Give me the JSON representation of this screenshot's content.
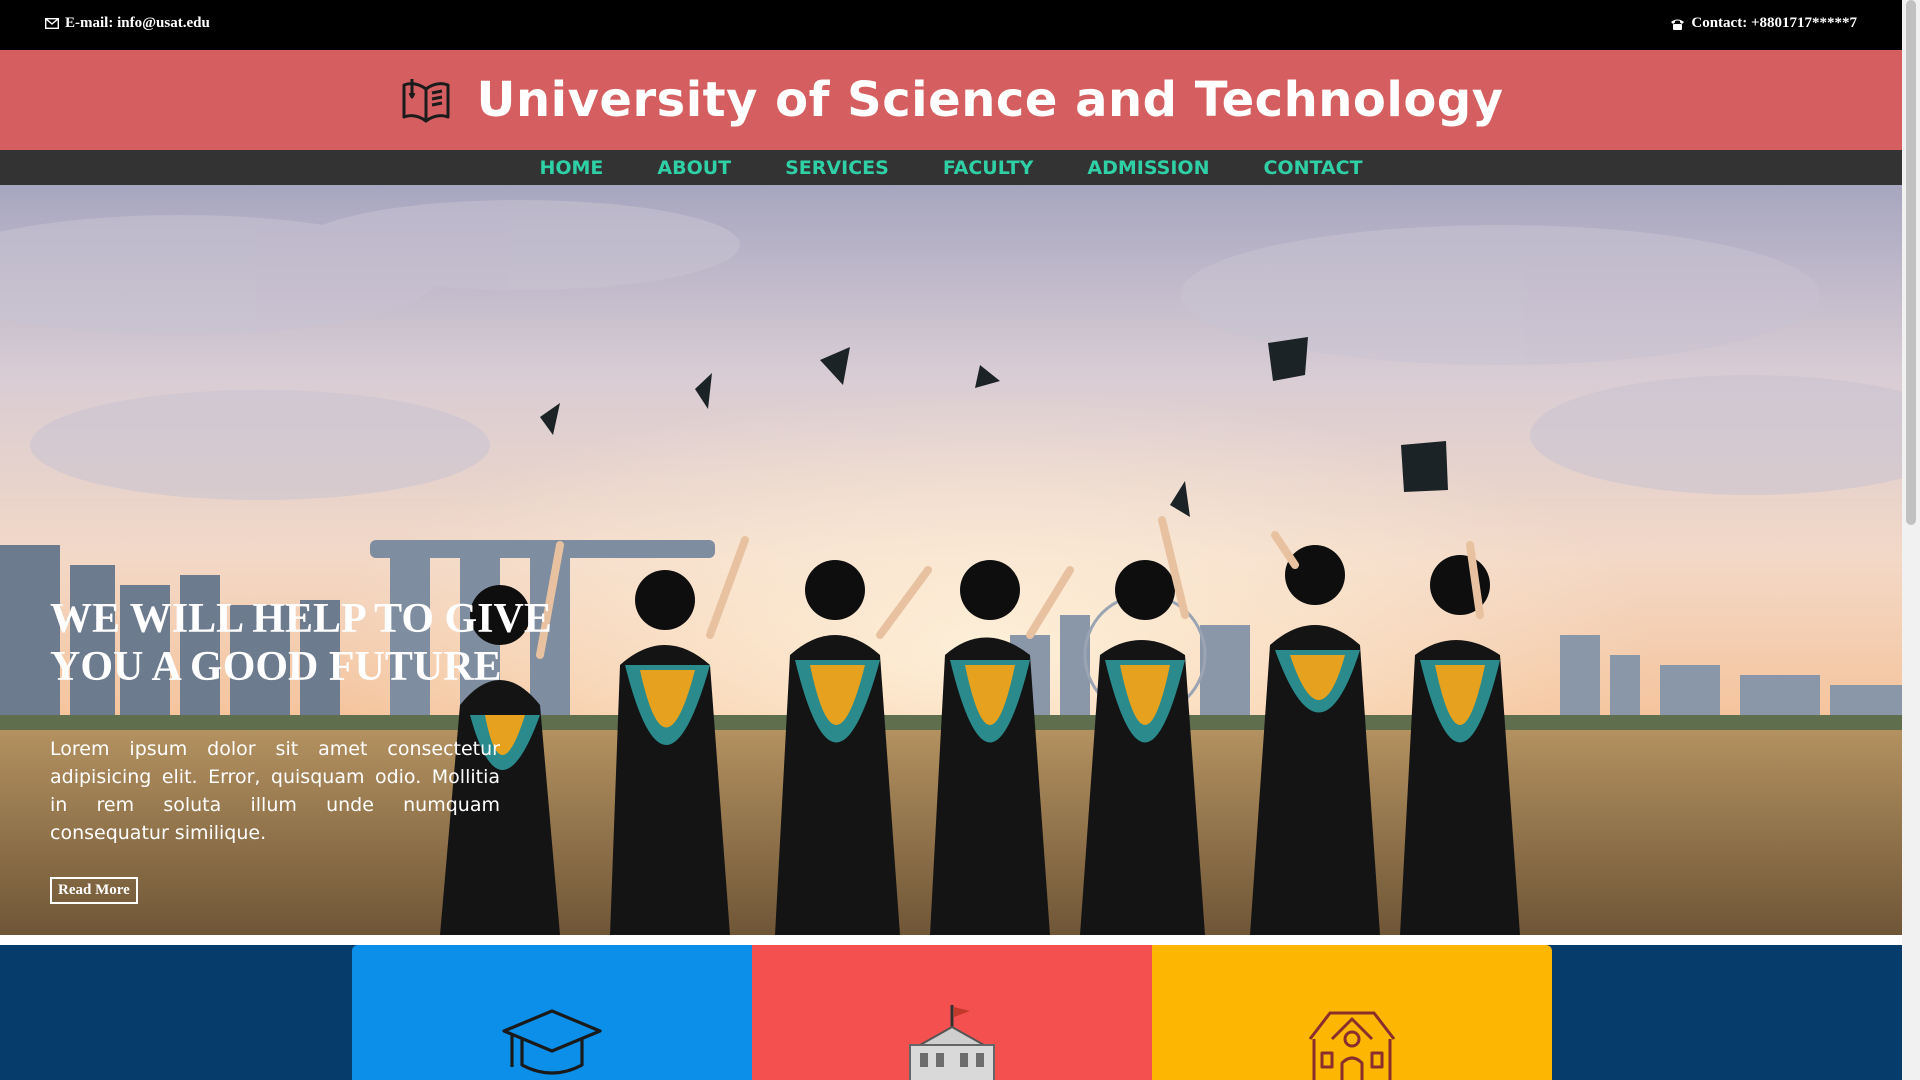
{
  "topbar": {
    "email": "E-mail: info@usat.edu",
    "contact": "Contact: +8801717*****7",
    "email_icon": "envelope-icon",
    "phone_icon": "phone-icon"
  },
  "header": {
    "title": "University of Science and Technology",
    "logo_icon": "book-icon"
  },
  "nav": {
    "items": [
      {
        "label": "HOME"
      },
      {
        "label": "ABOUT"
      },
      {
        "label": "SERVICES"
      },
      {
        "label": "FACULTY"
      },
      {
        "label": "ADMISSION"
      },
      {
        "label": "CONTACT"
      }
    ]
  },
  "hero": {
    "headline_line1": "WE WILL HELP TO GIVE",
    "headline_line2": "YOU A GOOD FUTURE",
    "paragraph": "Lorem ipsum dolor sit amet consectetur adipisicing elit. Error, quisquam odio. Mollitia in rem soluta illum unde numquam consequatur similique.",
    "read_more": "Read More",
    "image": "graduates-throwing-caps-photo"
  },
  "features": {
    "cards": [
      {
        "icon": "graduation-cap-icon",
        "color": "#0c8fe8"
      },
      {
        "icon": "university-building-icon",
        "color": "#f55050"
      },
      {
        "icon": "school-building-icon",
        "color": "#fdb702"
      }
    ]
  },
  "colors": {
    "topbar_bg": "#000000",
    "header_bg": "#d55f60",
    "nav_bg": "#333333",
    "nav_link": "#2fd0a6",
    "features_bg": "#053c6c"
  }
}
